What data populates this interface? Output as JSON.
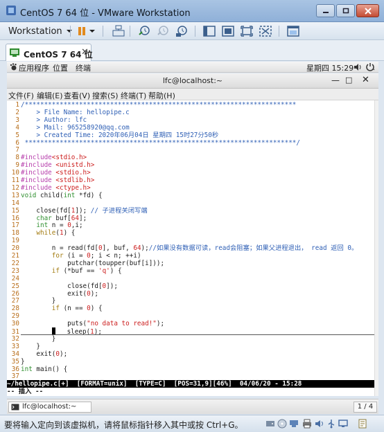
{
  "window": {
    "title": "CentOS 7 64 位 - VMware Workstation"
  },
  "toolbar": {
    "workstation_label": "Workstation",
    "icons": [
      "pause-icon",
      "send-keys-icon",
      "snapshot-take-icon",
      "snapshot-revert-icon",
      "snapshot-manager-icon",
      "library-view-icon",
      "console-view-icon",
      "fullscreen-icon",
      "unity-icon",
      "thumbnail-icon"
    ]
  },
  "tab": {
    "label": "CentOS 7 64 位"
  },
  "gnome": {
    "applications": "应用程序",
    "places": "位置",
    "terminal": "终端",
    "clock": "星期四 15:29"
  },
  "terminal": {
    "title": "lfc@localhost:~",
    "menu": [
      "文件(F)",
      "编辑(E)",
      "查看(V)",
      "搜索(S)",
      "终端(T)",
      "帮助(H)"
    ],
    "lines": [
      {
        "n": "1",
        "segs": [
          {
            "t": "/**********************************************************************",
            "c": "com"
          }
        ]
      },
      {
        "n": "2",
        "segs": [
          {
            "t": "    > File Name: hellopipe.c",
            "c": "com"
          }
        ]
      },
      {
        "n": "3",
        "segs": [
          {
            "t": "    > Author: lfc",
            "c": "com"
          }
        ]
      },
      {
        "n": "4",
        "segs": [
          {
            "t": "    > Mail: 965258920@qq.com",
            "c": "com"
          }
        ]
      },
      {
        "n": "5",
        "segs": [
          {
            "t": "    > Created Time: 2020年06月04日 星期四 15时27分50秒",
            "c": "com"
          }
        ]
      },
      {
        "n": "6",
        "segs": [
          {
            "t": " **********************************************************************/",
            "c": "com"
          }
        ]
      },
      {
        "n": "7",
        "segs": []
      },
      {
        "n": "8",
        "segs": [
          {
            "t": "#include",
            "c": "pre"
          },
          {
            "t": "<stdio.h>",
            "c": "inc"
          }
        ]
      },
      {
        "n": "9",
        "segs": [
          {
            "t": "#include ",
            "c": "pre"
          },
          {
            "t": "<unistd.h>",
            "c": "inc"
          }
        ]
      },
      {
        "n": "10",
        "segs": [
          {
            "t": "#include ",
            "c": "pre"
          },
          {
            "t": "<stdio.h>",
            "c": "inc"
          }
        ]
      },
      {
        "n": "11",
        "segs": [
          {
            "t": "#include ",
            "c": "pre"
          },
          {
            "t": "<stdlib.h>",
            "c": "inc"
          }
        ]
      },
      {
        "n": "12",
        "segs": [
          {
            "t": "#include ",
            "c": "pre"
          },
          {
            "t": "<ctype.h>",
            "c": "inc"
          }
        ]
      },
      {
        "n": "13",
        "segs": [
          {
            "t": "void",
            "c": "typ"
          },
          {
            "t": " child(",
            "c": "norm"
          },
          {
            "t": "int",
            "c": "typ"
          },
          {
            "t": " *fd) {",
            "c": "norm"
          }
        ]
      },
      {
        "n": "14",
        "segs": []
      },
      {
        "n": "15",
        "segs": [
          {
            "t": "    close(fd[",
            "c": "norm"
          },
          {
            "t": "1",
            "c": "num"
          },
          {
            "t": "]); ",
            "c": "norm"
          },
          {
            "t": "// 子进程关闭写端",
            "c": "com"
          }
        ]
      },
      {
        "n": "16",
        "segs": [
          {
            "t": "    ",
            "c": "norm"
          },
          {
            "t": "char",
            "c": "typ"
          },
          {
            "t": " buf[",
            "c": "norm"
          },
          {
            "t": "64",
            "c": "num"
          },
          {
            "t": "];",
            "c": "norm"
          }
        ]
      },
      {
        "n": "17",
        "segs": [
          {
            "t": "    ",
            "c": "norm"
          },
          {
            "t": "int",
            "c": "typ"
          },
          {
            "t": " n = ",
            "c": "norm"
          },
          {
            "t": "0",
            "c": "num"
          },
          {
            "t": ",i;",
            "c": "norm"
          }
        ]
      },
      {
        "n": "18",
        "segs": [
          {
            "t": "    ",
            "c": "norm"
          },
          {
            "t": "while",
            "c": "kw"
          },
          {
            "t": "(",
            "c": "norm"
          },
          {
            "t": "1",
            "c": "num"
          },
          {
            "t": ") {",
            "c": "norm"
          }
        ]
      },
      {
        "n": "19",
        "segs": []
      },
      {
        "n": "20",
        "segs": [
          {
            "t": "        n = read(fd[",
            "c": "norm"
          },
          {
            "t": "0",
            "c": "num"
          },
          {
            "t": "], buf, ",
            "c": "norm"
          },
          {
            "t": "64",
            "c": "num"
          },
          {
            "t": ");",
            "c": "norm"
          },
          {
            "t": "//如果没有数据可读，read会阻塞；如果父进程退出， read 返回 0。",
            "c": "com"
          }
        ]
      },
      {
        "n": "21",
        "segs": [
          {
            "t": "        ",
            "c": "norm"
          },
          {
            "t": "for",
            "c": "kw"
          },
          {
            "t": " (i = ",
            "c": "norm"
          },
          {
            "t": "0",
            "c": "num"
          },
          {
            "t": "; i < n; ++i)",
            "c": "norm"
          }
        ]
      },
      {
        "n": "22",
        "segs": [
          {
            "t": "            putchar(toupper(buf[i]));",
            "c": "norm"
          }
        ]
      },
      {
        "n": "23",
        "segs": [
          {
            "t": "        ",
            "c": "norm"
          },
          {
            "t": "if",
            "c": "kw"
          },
          {
            "t": " (*buf == ",
            "c": "norm"
          },
          {
            "t": "'q'",
            "c": "str"
          },
          {
            "t": ") {",
            "c": "norm"
          }
        ]
      },
      {
        "n": "24",
        "segs": []
      },
      {
        "n": "25",
        "segs": [
          {
            "t": "            close(fd[",
            "c": "norm"
          },
          {
            "t": "0",
            "c": "num"
          },
          {
            "t": "]);",
            "c": "norm"
          }
        ]
      },
      {
        "n": "26",
        "segs": [
          {
            "t": "            exit(",
            "c": "norm"
          },
          {
            "t": "0",
            "c": "num"
          },
          {
            "t": ");",
            "c": "norm"
          }
        ]
      },
      {
        "n": "27",
        "segs": [
          {
            "t": "        }",
            "c": "norm"
          }
        ]
      },
      {
        "n": "28",
        "segs": [
          {
            "t": "        ",
            "c": "norm"
          },
          {
            "t": "if",
            "c": "kw"
          },
          {
            "t": " (n == ",
            "c": "norm"
          },
          {
            "t": "0",
            "c": "num"
          },
          {
            "t": ") {",
            "c": "norm"
          }
        ]
      },
      {
        "n": "29",
        "segs": []
      },
      {
        "n": "30",
        "segs": [
          {
            "t": "            puts(",
            "c": "norm"
          },
          {
            "t": "\"no data to read!\"",
            "c": "str"
          },
          {
            "t": ");",
            "c": "norm"
          }
        ]
      },
      {
        "n": "31",
        "segs": [
          {
            "t": "        ",
            "c": "norm"
          },
          {
            "t": "CURSOR",
            "c": "cursor"
          },
          {
            "t": "   sleep(",
            "c": "norm"
          },
          {
            "t": "1",
            "c": "num"
          },
          {
            "t": ");",
            "c": "norm"
          }
        ]
      },
      {
        "n": "32",
        "segs": [
          {
            "t": "        }",
            "c": "norm"
          }
        ]
      },
      {
        "n": "33",
        "segs": [
          {
            "t": "    }",
            "c": "norm"
          }
        ]
      },
      {
        "n": "34",
        "segs": [
          {
            "t": "    exit(",
            "c": "norm"
          },
          {
            "t": "0",
            "c": "num"
          },
          {
            "t": ");",
            "c": "norm"
          }
        ]
      },
      {
        "n": "35",
        "segs": [
          {
            "t": "}",
            "c": "norm"
          }
        ]
      },
      {
        "n": "36",
        "segs": [
          {
            "t": "int",
            "c": "typ"
          },
          {
            "t": " main() {",
            "c": "norm"
          }
        ]
      },
      {
        "n": "37",
        "segs": []
      }
    ],
    "status_line": "~/hellopipe.c[+]  [FORMAT=unix]  [TYPE=C]  [POS=31,9][46%]  04/06/20 - 15:28",
    "mode_line": "-- 插入 --"
  },
  "taskbar": {
    "item": "lfc@localhost:~",
    "workspace": "1 / 4"
  },
  "status": {
    "hint": "要将输入定向到该虚拟机，请将鼠标指针移入其中或按 Ctrl+G。"
  },
  "colors": {
    "line_number": "#b86e1a",
    "comment": "#2e5fb5",
    "preprocessor": "#b63dab",
    "string_number": "#cc1d1d",
    "type": "#2f8f2f",
    "keyword": "#a37b10"
  }
}
